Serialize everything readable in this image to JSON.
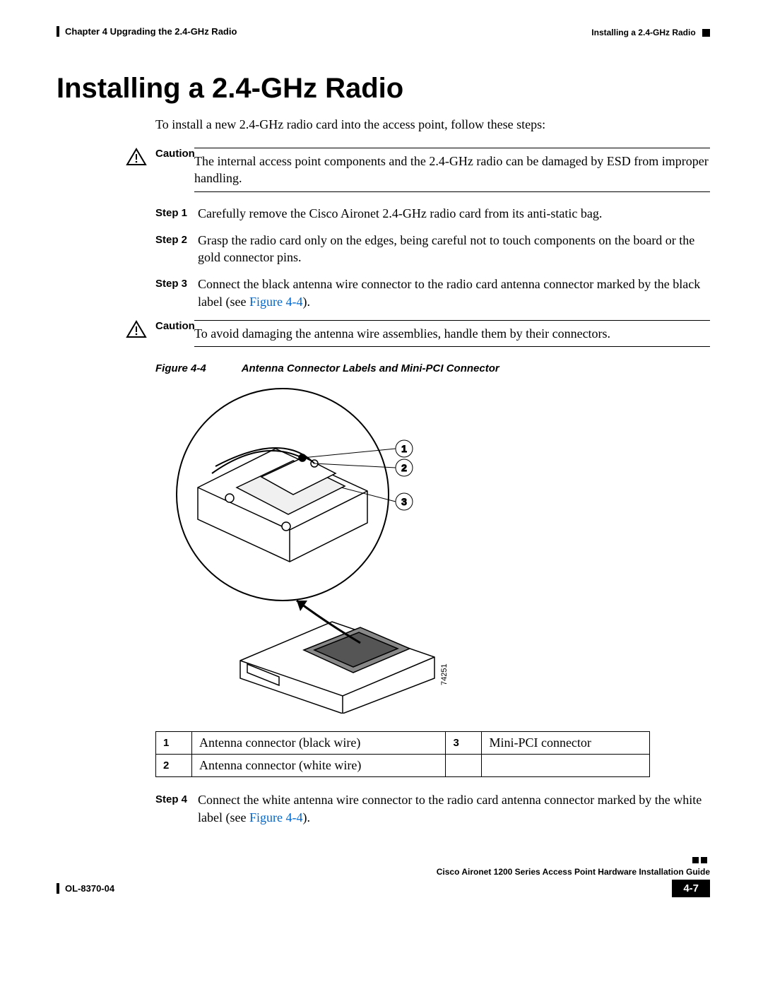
{
  "header": {
    "chapter": "Chapter 4      Upgrading the 2.4-GHz Radio",
    "section": "Installing a 2.4-GHz Radio"
  },
  "title": "Installing a 2.4-GHz Radio",
  "intro": "To install a new 2.4-GHz radio card into the access point, follow these steps:",
  "caution1": {
    "label": "Caution",
    "text": "The internal access point components and the 2.4-GHz radio can be damaged by ESD from improper handling."
  },
  "steps": {
    "s1": {
      "label": "Step 1",
      "text": "Carefully remove the Cisco Aironet 2.4-GHz radio card from its anti-static bag."
    },
    "s2": {
      "label": "Step 2",
      "text": "Grasp the radio card only on the edges, being careful not to touch components on the board or the gold connector pins."
    },
    "s3": {
      "label": "Step 3",
      "text_before": "Connect the black antenna wire connector to the radio card antenna connector marked by the black label (see ",
      "link": "Figure 4-4",
      "text_after": ")."
    },
    "s4": {
      "label": "Step 4",
      "text_before": "Connect the white antenna wire connector to the radio card antenna connector marked by the white label (see ",
      "link": "Figure 4-4",
      "text_after": ")."
    }
  },
  "caution2": {
    "label": "Caution",
    "text": "To avoid damaging the antenna wire assemblies, handle them by their connectors."
  },
  "figure": {
    "num": "Figure 4-4",
    "title": "Antenna Connector Labels and Mini-PCI Connector",
    "callouts": {
      "c1": "1",
      "c2": "2",
      "c3": "3"
    },
    "drawing_num": "74251"
  },
  "table": {
    "r1n": "1",
    "r1t": "Antenna connector (black wire)",
    "r2n": "2",
    "r2t": "Antenna connector (white wire)",
    "r3n": "3",
    "r3t": "Mini-PCI connector"
  },
  "footer": {
    "book": "Cisco Aironet 1200 Series Access Point Hardware Installation Guide",
    "docnum": "OL-8370-04",
    "page": "4-7"
  }
}
